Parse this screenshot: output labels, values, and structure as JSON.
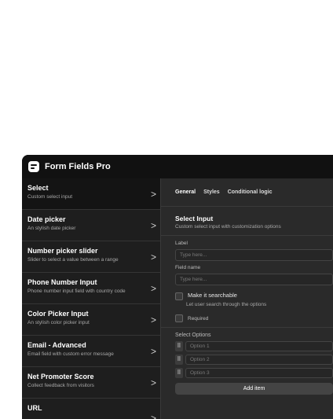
{
  "app": {
    "title": "Form Fields Pro"
  },
  "sidebar": {
    "items": [
      {
        "name": "Select",
        "desc": "Custom select input"
      },
      {
        "name": "Date picker",
        "desc": "An stylish date picker"
      },
      {
        "name": "Number picker slider",
        "desc": "Slider to select a value between a range"
      },
      {
        "name": "Phone Number Input",
        "desc": "Phone number input field with country code"
      },
      {
        "name": "Color Picker Input",
        "desc": "An stylish color picker input"
      },
      {
        "name": "Email - Advanced",
        "desc": "Email field with custom error message"
      },
      {
        "name": "Net Promoter Score",
        "desc": "Collect feedback from visitors"
      },
      {
        "name": "URL",
        "desc": ""
      }
    ],
    "chevron": ">"
  },
  "tabs": [
    {
      "label": "General"
    },
    {
      "label": "Styles"
    },
    {
      "label": "Conditional logic"
    }
  ],
  "panel": {
    "title": "Select Input",
    "subtitle": "Custom select input with customization options",
    "label_label": "Label",
    "label_placeholder": "Type here...",
    "fieldname_label": "Field name",
    "fieldname_placeholder": "Type here...",
    "searchable_label": "Make it searchable",
    "searchable_hint": "Let user search through the options",
    "required_label": "Required",
    "options_title": "Select Options",
    "options": [
      "Option 1",
      "Option 2",
      "Option 3"
    ],
    "add_button": "Add item"
  }
}
